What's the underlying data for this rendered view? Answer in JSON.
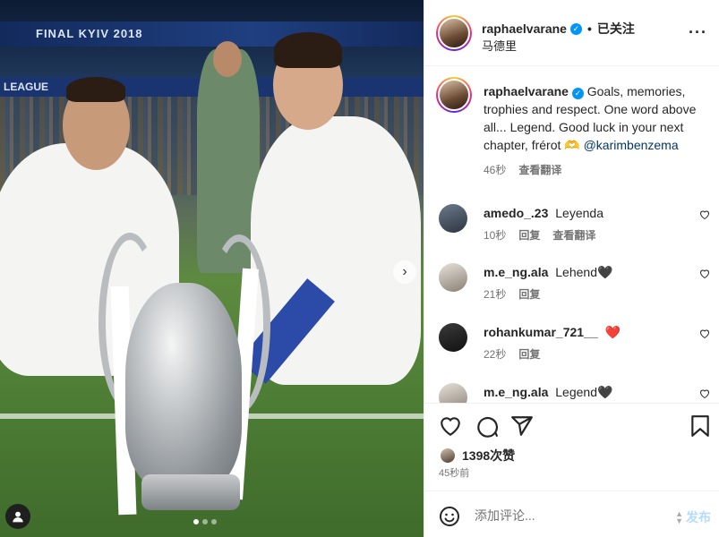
{
  "photo": {
    "banner_text": "FINAL KYIV 2018",
    "banner2_text": "LEAGUE",
    "next_arrow": "›"
  },
  "header": {
    "username": "raphaelvarane",
    "follow_status": "已关注",
    "separator": "•",
    "location": "马德里",
    "more_icon": "more-horizontal-icon"
  },
  "caption": {
    "username": "raphaelvarane",
    "text": "Goals, memories, trophies and respect. One word above all... Legend. Good luck in your next chapter, frérot 🫶",
    "mention": "@karimbenzema",
    "time": "46秒",
    "translate": "查看翻译"
  },
  "comments": [
    {
      "username": "amedo_.23",
      "text": "Leyenda",
      "time": "10秒",
      "reply": "回复",
      "translate": "查看翻译"
    },
    {
      "username": "m.e_ng.ala",
      "text": "Lehend🖤",
      "time": "21秒",
      "reply": "回复",
      "translate": ""
    },
    {
      "username": "rohankumar_721__",
      "text": "❤️",
      "time": "22秒",
      "reply": "回复",
      "translate": ""
    },
    {
      "username": "m.e_ng.ala",
      "text": "Legend🖤",
      "time": "",
      "reply": "",
      "translate": ""
    }
  ],
  "actions": {
    "likes": "1398次赞",
    "time_ago": "45秒前"
  },
  "composer": {
    "placeholder": "添加评论...",
    "post_label": "发布"
  },
  "colors": {
    "accent": "#0095f6",
    "heart_red": "#ed4956",
    "post_disabled": "#b3dbff"
  }
}
